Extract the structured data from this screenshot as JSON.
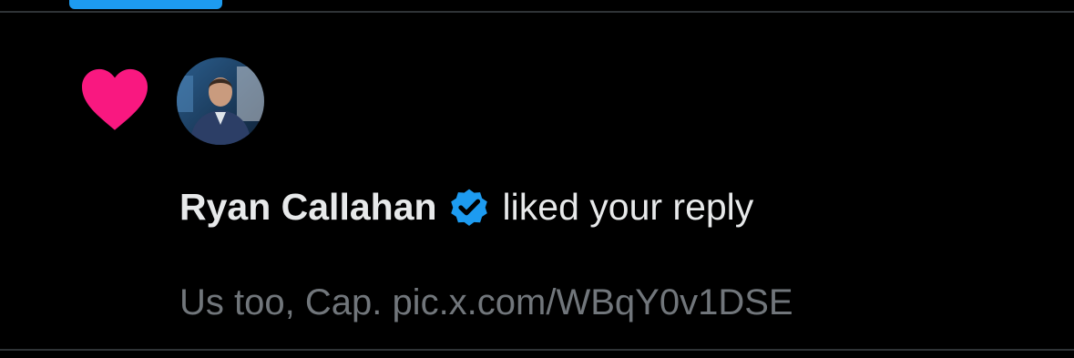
{
  "notification": {
    "type_icon": "heart-icon",
    "avatar_icon": "user-avatar",
    "user_name": "Ryan Callahan",
    "verified_icon": "verified-badge-icon",
    "action_text": "liked your reply",
    "reply_text": "Us too, Cap. pic.x.com/WBqY0v1DSE"
  },
  "colors": {
    "background": "#000000",
    "tab_indicator": "#1d9bf0",
    "heart": "#f91880",
    "verified": "#1d9bf0",
    "primary_text": "#e7e9ea",
    "secondary_text": "#71767b",
    "divider": "#2f3336"
  }
}
